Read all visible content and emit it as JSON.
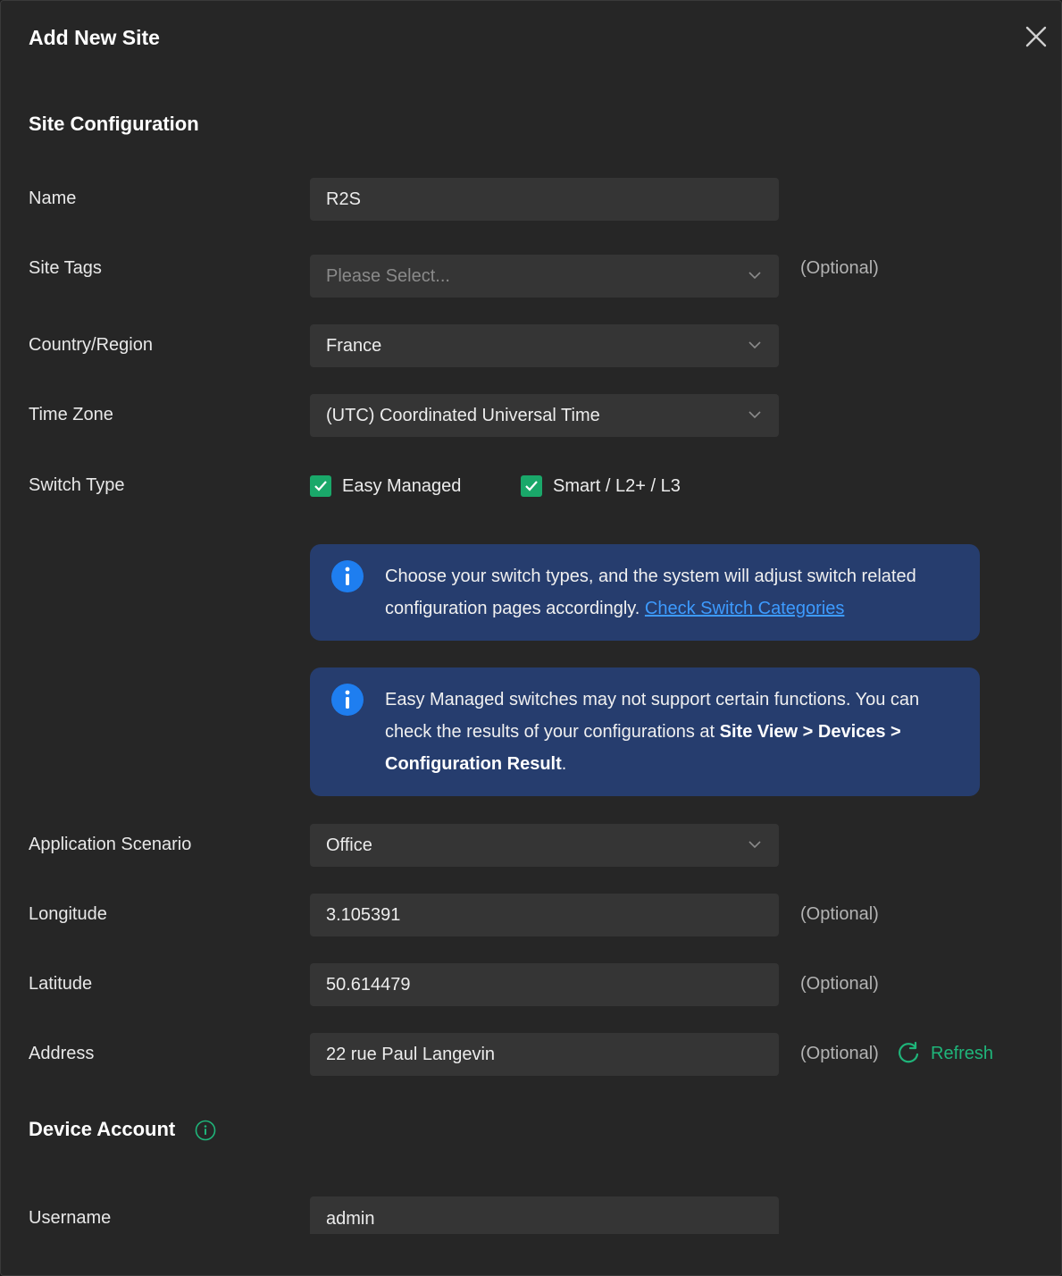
{
  "dialog": {
    "title": "Add New Site",
    "close_icon": "close-icon"
  },
  "site_configuration": {
    "heading": "Site Configuration",
    "name": {
      "label": "Name",
      "value": "R2S"
    },
    "site_tags": {
      "label": "Site Tags",
      "placeholder": "Please Select...",
      "hint": "(Optional)"
    },
    "country": {
      "label": "Country/Region",
      "value": "France"
    },
    "time_zone": {
      "label": "Time Zone",
      "value": "(UTC) Coordinated Universal Time"
    },
    "switch_type": {
      "label": "Switch Type",
      "options": [
        {
          "label": "Easy Managed",
          "checked": true
        },
        {
          "label": "Smart / L2+ / L3",
          "checked": true
        }
      ]
    },
    "info1": {
      "text": "Choose your switch types, and the system will adjust switch related configuration pages accordingly.",
      "link": "Check Switch Categories"
    },
    "info2": {
      "text_before": "Easy Managed switches may not support certain functions. You can check the results of your configurations at",
      "bold": "Site View > Devices > Configuration Result",
      "text_after": "."
    },
    "scenario": {
      "label": "Application Scenario",
      "value": "Office"
    },
    "longitude": {
      "label": "Longitude",
      "value": "3.105391",
      "hint": "(Optional)"
    },
    "latitude": {
      "label": "Latitude",
      "value": "50.614479",
      "hint": "(Optional)"
    },
    "address": {
      "label": "Address",
      "value": "22 rue Paul Langevin",
      "hint": "(Optional)",
      "refresh": "Refresh"
    }
  },
  "device_account": {
    "heading": "Device Account",
    "username": {
      "label": "Username",
      "value": "admin"
    }
  },
  "colors": {
    "background": "#262626",
    "field": "#353535",
    "accent_green": "#1fb57a",
    "info_bg": "#263d6e",
    "info_icon": "#1e7ef0",
    "link": "#3d9bff"
  }
}
